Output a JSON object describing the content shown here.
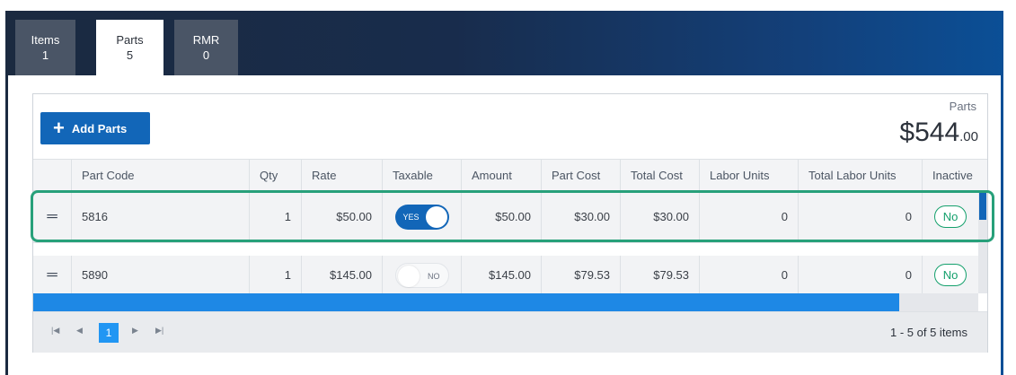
{
  "tabs": [
    {
      "label": "Items",
      "count": "1",
      "active": false
    },
    {
      "label": "Parts",
      "count": "5",
      "active": true
    },
    {
      "label": "RMR",
      "count": "0",
      "active": false
    }
  ],
  "toolbar": {
    "add_label": "Add Parts",
    "add_icon": "plus-icon"
  },
  "summary": {
    "label": "Parts",
    "value": "$544",
    "cents": ".00"
  },
  "columns": [
    "",
    "Part Code",
    "Qty",
    "Rate",
    "Taxable",
    "Amount",
    "Part Cost",
    "Total Cost",
    "Labor Units",
    "Total Labor Units",
    "Inactive"
  ],
  "rows": [
    {
      "part_code": "5816",
      "qty": "1",
      "rate": "$50.00",
      "taxable": "YES",
      "amount": "$50.00",
      "part_cost": "$30.00",
      "total_cost": "$30.00",
      "labor_units": "0",
      "total_labor_units": "0",
      "inactive": "No"
    },
    {
      "part_code": "5890",
      "qty": "1",
      "rate": "$145.00",
      "taxable": "NO",
      "amount": "$145.00",
      "part_cost": "$79.53",
      "total_cost": "$79.53",
      "labor_units": "0",
      "total_labor_units": "0",
      "inactive": "No"
    }
  ],
  "pager": {
    "current_page": "1",
    "info": "1 - 5 of 5 items"
  },
  "colors": {
    "accent": "#1266b8",
    "highlight": "#27a07a",
    "inactive_pill": "#14a06c",
    "header_dark": "#1b2a40"
  }
}
